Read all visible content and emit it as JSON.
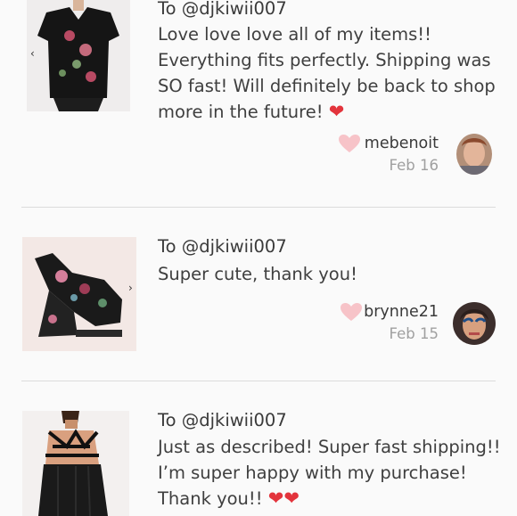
{
  "reviews": [
    {
      "to": "To @djkiwii007",
      "message": "Love love love all of my items!! Everything fits perfectly. Shipping was SO fast! Will definitely be back to shop more in the future!",
      "emoji": "❤",
      "username": "mebenoit",
      "date": "Feb 16",
      "item": "Floral black top"
    },
    {
      "to": "To @djkiwii007",
      "message": "Super cute, thank you!",
      "emoji": "",
      "username": "brynne21",
      "date": "Feb 15",
      "item": "Floral wedge sandal"
    },
    {
      "to": "To @djkiwii007",
      "message": "Just as described! Super fast shipping!! I’m super happy with my purchase! Thank you!!",
      "emoji": "❤❤",
      "username": "",
      "date": "",
      "item": "Black strappy dress"
    }
  ],
  "colors": {
    "background": "#fafafa",
    "heart_favorite": "#f7c3c8",
    "heart_emoji": "#e3343c",
    "date": "#a0a0a0",
    "divider": "#dcdcdc"
  },
  "icons": [
    "heart-icon",
    "chevron-right-icon",
    "avatar"
  ]
}
